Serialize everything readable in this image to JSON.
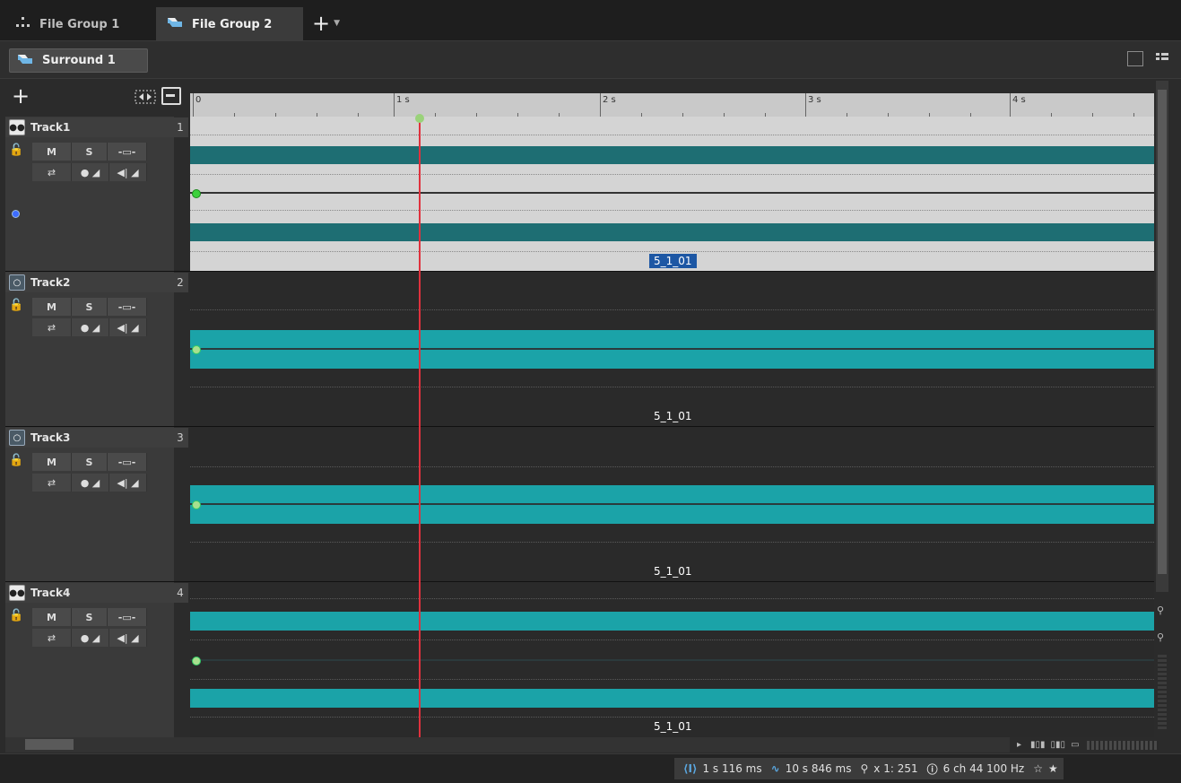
{
  "tabs": [
    {
      "label": "File Group 1",
      "icon": "grid-icon",
      "active": false
    },
    {
      "label": "File Group 2",
      "icon": "montage-icon",
      "active": true
    }
  ],
  "group": {
    "label": "Surround 1",
    "icon": "montage-icon"
  },
  "ruler": {
    "labels": [
      "0",
      "1 s",
      "2 s",
      "3 s",
      "4 s"
    ]
  },
  "tracks": [
    {
      "name": "Track1",
      "number": "1",
      "mode": "stereo",
      "clip": "5_1_01",
      "selected": true
    },
    {
      "name": "Track2",
      "number": "2",
      "mode": "mono",
      "clip": "5_1_01",
      "selected": false
    },
    {
      "name": "Track3",
      "number": "3",
      "mode": "mono",
      "clip": "5_1_01",
      "selected": false
    },
    {
      "name": "Track4",
      "number": "4",
      "mode": "stereo",
      "clip": "5_1_01",
      "selected": false
    }
  ],
  "track_buttons": {
    "mute": "M",
    "solo": "S"
  },
  "status": {
    "cursor_position": "1 s 116 ms",
    "length": "10 s 846 ms",
    "zoom": "x 1: 251",
    "info": "6 ch 44 100 Hz"
  },
  "colors": {
    "playhead": "#e0313d",
    "clip_selected": "#1d57a4",
    "waveform_teal": "#1ba3a8",
    "waveform_dark_teal": "#1e6e73",
    "accent_blue": "#5aa7e0"
  }
}
